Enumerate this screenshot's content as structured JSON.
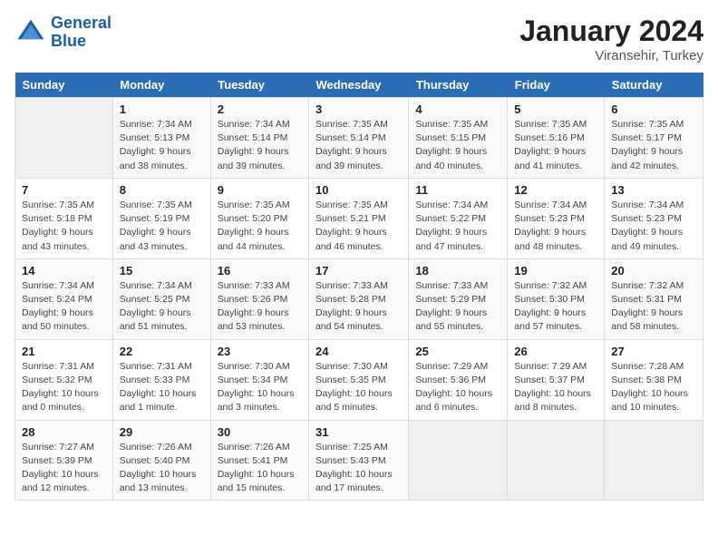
{
  "header": {
    "logo_line1": "General",
    "logo_line2": "Blue",
    "month": "January 2024",
    "location": "Viransehir, Turkey"
  },
  "weekdays": [
    "Sunday",
    "Monday",
    "Tuesday",
    "Wednesday",
    "Thursday",
    "Friday",
    "Saturday"
  ],
  "weeks": [
    [
      {
        "num": "",
        "info": ""
      },
      {
        "num": "1",
        "info": "Sunrise: 7:34 AM\nSunset: 5:13 PM\nDaylight: 9 hours\nand 38 minutes."
      },
      {
        "num": "2",
        "info": "Sunrise: 7:34 AM\nSunset: 5:14 PM\nDaylight: 9 hours\nand 39 minutes."
      },
      {
        "num": "3",
        "info": "Sunrise: 7:35 AM\nSunset: 5:14 PM\nDaylight: 9 hours\nand 39 minutes."
      },
      {
        "num": "4",
        "info": "Sunrise: 7:35 AM\nSunset: 5:15 PM\nDaylight: 9 hours\nand 40 minutes."
      },
      {
        "num": "5",
        "info": "Sunrise: 7:35 AM\nSunset: 5:16 PM\nDaylight: 9 hours\nand 41 minutes."
      },
      {
        "num": "6",
        "info": "Sunrise: 7:35 AM\nSunset: 5:17 PM\nDaylight: 9 hours\nand 42 minutes."
      }
    ],
    [
      {
        "num": "7",
        "info": "Sunrise: 7:35 AM\nSunset: 5:18 PM\nDaylight: 9 hours\nand 43 minutes."
      },
      {
        "num": "8",
        "info": "Sunrise: 7:35 AM\nSunset: 5:19 PM\nDaylight: 9 hours\nand 43 minutes."
      },
      {
        "num": "9",
        "info": "Sunrise: 7:35 AM\nSunset: 5:20 PM\nDaylight: 9 hours\nand 44 minutes."
      },
      {
        "num": "10",
        "info": "Sunrise: 7:35 AM\nSunset: 5:21 PM\nDaylight: 9 hours\nand 46 minutes."
      },
      {
        "num": "11",
        "info": "Sunrise: 7:34 AM\nSunset: 5:22 PM\nDaylight: 9 hours\nand 47 minutes."
      },
      {
        "num": "12",
        "info": "Sunrise: 7:34 AM\nSunset: 5:23 PM\nDaylight: 9 hours\nand 48 minutes."
      },
      {
        "num": "13",
        "info": "Sunrise: 7:34 AM\nSunset: 5:23 PM\nDaylight: 9 hours\nand 49 minutes."
      }
    ],
    [
      {
        "num": "14",
        "info": "Sunrise: 7:34 AM\nSunset: 5:24 PM\nDaylight: 9 hours\nand 50 minutes."
      },
      {
        "num": "15",
        "info": "Sunrise: 7:34 AM\nSunset: 5:25 PM\nDaylight: 9 hours\nand 51 minutes."
      },
      {
        "num": "16",
        "info": "Sunrise: 7:33 AM\nSunset: 5:26 PM\nDaylight: 9 hours\nand 53 minutes."
      },
      {
        "num": "17",
        "info": "Sunrise: 7:33 AM\nSunset: 5:28 PM\nDaylight: 9 hours\nand 54 minutes."
      },
      {
        "num": "18",
        "info": "Sunrise: 7:33 AM\nSunset: 5:29 PM\nDaylight: 9 hours\nand 55 minutes."
      },
      {
        "num": "19",
        "info": "Sunrise: 7:32 AM\nSunset: 5:30 PM\nDaylight: 9 hours\nand 57 minutes."
      },
      {
        "num": "20",
        "info": "Sunrise: 7:32 AM\nSunset: 5:31 PM\nDaylight: 9 hours\nand 58 minutes."
      }
    ],
    [
      {
        "num": "21",
        "info": "Sunrise: 7:31 AM\nSunset: 5:32 PM\nDaylight: 10 hours\nand 0 minutes."
      },
      {
        "num": "22",
        "info": "Sunrise: 7:31 AM\nSunset: 5:33 PM\nDaylight: 10 hours\nand 1 minute."
      },
      {
        "num": "23",
        "info": "Sunrise: 7:30 AM\nSunset: 5:34 PM\nDaylight: 10 hours\nand 3 minutes."
      },
      {
        "num": "24",
        "info": "Sunrise: 7:30 AM\nSunset: 5:35 PM\nDaylight: 10 hours\nand 5 minutes."
      },
      {
        "num": "25",
        "info": "Sunrise: 7:29 AM\nSunset: 5:36 PM\nDaylight: 10 hours\nand 6 minutes."
      },
      {
        "num": "26",
        "info": "Sunrise: 7:29 AM\nSunset: 5:37 PM\nDaylight: 10 hours\nand 8 minutes."
      },
      {
        "num": "27",
        "info": "Sunrise: 7:28 AM\nSunset: 5:38 PM\nDaylight: 10 hours\nand 10 minutes."
      }
    ],
    [
      {
        "num": "28",
        "info": "Sunrise: 7:27 AM\nSunset: 5:39 PM\nDaylight: 10 hours\nand 12 minutes."
      },
      {
        "num": "29",
        "info": "Sunrise: 7:26 AM\nSunset: 5:40 PM\nDaylight: 10 hours\nand 13 minutes."
      },
      {
        "num": "30",
        "info": "Sunrise: 7:26 AM\nSunset: 5:41 PM\nDaylight: 10 hours\nand 15 minutes."
      },
      {
        "num": "31",
        "info": "Sunrise: 7:25 AM\nSunset: 5:43 PM\nDaylight: 10 hours\nand 17 minutes."
      },
      {
        "num": "",
        "info": ""
      },
      {
        "num": "",
        "info": ""
      },
      {
        "num": "",
        "info": ""
      }
    ]
  ]
}
